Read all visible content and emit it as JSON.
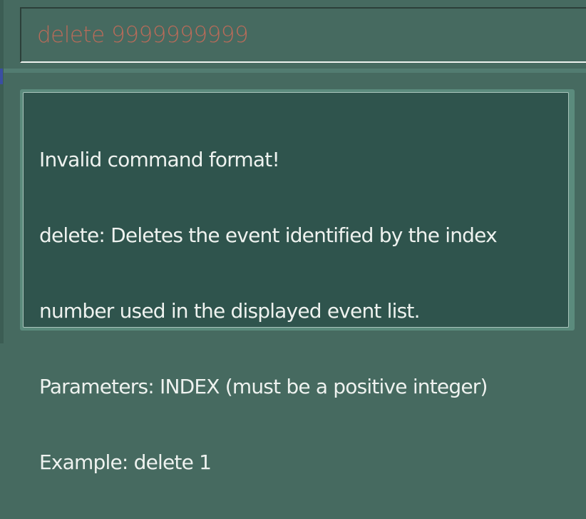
{
  "command": {
    "value": "delete 9999999999",
    "text_color": "#b96b59"
  },
  "result": {
    "lines": [
      "Invalid command format!",
      "delete: Deletes the event identified by the index",
      "number used in the displayed event list.",
      "Parameters: INDEX (must be a positive integer)",
      "Example: delete 1"
    ],
    "text_color": "#eef2ef",
    "background": "#2f544d"
  },
  "theme": {
    "window_background": "#466a60",
    "accent": "#3a4ea2"
  }
}
